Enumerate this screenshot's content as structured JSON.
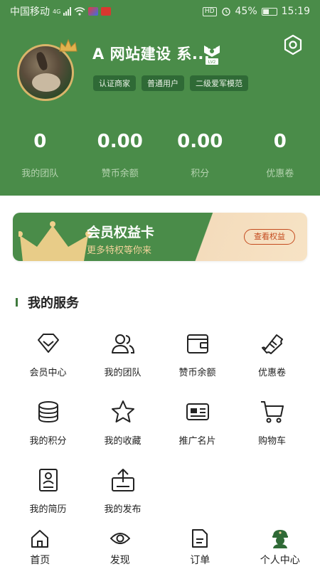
{
  "status_bar": {
    "carrier": "中国移动",
    "network": "4G",
    "battery": "45%",
    "battery_level": 0.45,
    "time": "15:19",
    "hd": "HD"
  },
  "profile": {
    "username": "A 网站建设 系...",
    "level": "LV2",
    "tags": [
      "认证商家",
      "普通用户",
      "二级爱军模范"
    ]
  },
  "stats": [
    {
      "value": "0",
      "label": "我的团队"
    },
    {
      "value": "0.00",
      "label": "赞币余额"
    },
    {
      "value": "0.00",
      "label": "积分"
    },
    {
      "value": "0",
      "label": "优惠卷"
    }
  ],
  "member_card": {
    "title": "会员权益卡",
    "subtitle": "更多特权等你来",
    "button": "查看权益"
  },
  "services": {
    "title": "我的服务",
    "items": [
      {
        "label": "会员中心",
        "icon": "diamond-icon"
      },
      {
        "label": "我的团队",
        "icon": "users-icon"
      },
      {
        "label": "赞币余额",
        "icon": "wallet-icon"
      },
      {
        "label": "优惠卷",
        "icon": "ticket-icon"
      },
      {
        "label": "我的积分",
        "icon": "coins-icon"
      },
      {
        "label": "我的收藏",
        "icon": "star-icon"
      },
      {
        "label": "推广名片",
        "icon": "card-icon"
      },
      {
        "label": "购物车",
        "icon": "cart-icon"
      },
      {
        "label": "我的简历",
        "icon": "resume-icon"
      },
      {
        "label": "我的发布",
        "icon": "upload-icon"
      }
    ]
  },
  "tabbar": {
    "items": [
      {
        "label": "首页",
        "icon": "home-icon"
      },
      {
        "label": "发现",
        "icon": "eye-icon"
      },
      {
        "label": "订单",
        "icon": "document-icon"
      },
      {
        "label": "个人中心",
        "icon": "soldier-icon"
      }
    ],
    "active_index": 3
  },
  "colors": {
    "primary": "#4a8c49",
    "accent_gold": "#f1d29a",
    "button_orange": "#c44b1f"
  }
}
